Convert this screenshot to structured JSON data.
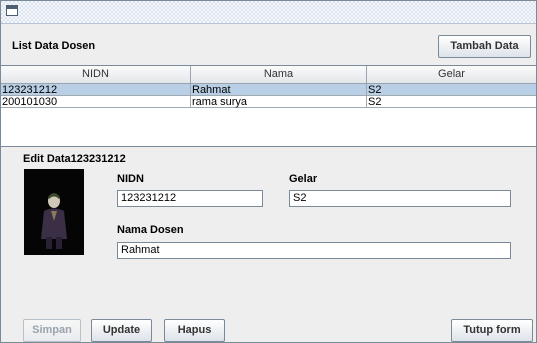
{
  "window": {
    "title": ""
  },
  "list": {
    "heading": "List Data Dosen",
    "add_button": "Tambah Data",
    "columns": [
      "NIDN",
      "Nama",
      "Gelar"
    ],
    "rows": [
      {
        "nidn": "123231212",
        "nama": "Rahmat",
        "gelar": "S2",
        "selected": true
      },
      {
        "nidn": "200101030",
        "nama": "rama surya",
        "gelar": "S2",
        "selected": false
      }
    ]
  },
  "edit": {
    "heading": "Edit Data123231212",
    "nidn_label": "NIDN",
    "nidn_value": "123231212",
    "gelar_label": "Gelar",
    "gelar_value": "S2",
    "nama_label": "Nama Dosen",
    "nama_value": "Rahmat"
  },
  "buttons": {
    "simpan": "Simpan",
    "update": "Update",
    "hapus": "Hapus",
    "tutup": "Tutup form"
  },
  "colors": {
    "selection": "#b8cfe5",
    "titlebar": "#dce4ef",
    "background": "#eeeeee"
  }
}
